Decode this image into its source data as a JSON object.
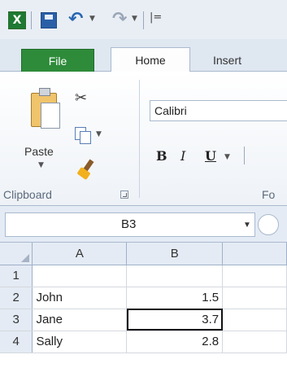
{
  "qat": {
    "logo": "X",
    "customize_glyph": "|=",
    "undo_glyph": "↶",
    "redo_glyph": "↷"
  },
  "tabs": [
    {
      "label": "File"
    },
    {
      "label": "Home"
    },
    {
      "label": "Insert"
    }
  ],
  "ribbon": {
    "paste_label": "Paste",
    "clipboard_group_label": "Clipboard",
    "font_name": "Calibri",
    "bold_label": "B",
    "italic_label": "I",
    "underline_label": "U",
    "font_group_label": "Fo"
  },
  "name_box": {
    "value": "B3"
  },
  "grid": {
    "columns": [
      "A",
      "B"
    ],
    "rows": [
      {
        "num": "1",
        "a": "",
        "b": ""
      },
      {
        "num": "2",
        "a": "John",
        "b": "1.5"
      },
      {
        "num": "3",
        "a": "Jane",
        "b": "3.7"
      },
      {
        "num": "4",
        "a": "Sally",
        "b": "2.8"
      }
    ],
    "selected_cell": "B3"
  },
  "colors": {
    "file_tab": "#2e8b3a",
    "ribbon_border": "#a9b9ce",
    "header_bg": "#e4ebf4"
  }
}
